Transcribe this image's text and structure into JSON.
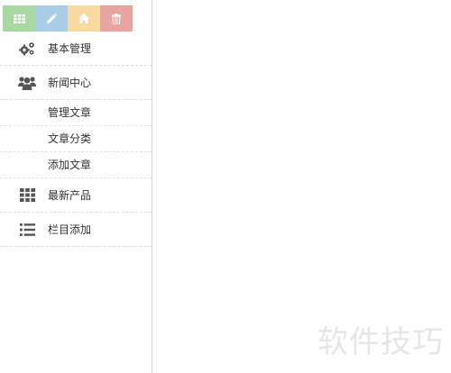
{
  "shortcuts": [
    {
      "icon": "grid-icon",
      "color": "#a8d9a0"
    },
    {
      "icon": "pencil-icon",
      "color": "#a9cde6"
    },
    {
      "icon": "home-icon",
      "color": "#f8d99f"
    },
    {
      "icon": "trash-icon",
      "color": "#e8a4a0"
    }
  ],
  "nav": {
    "basic_management": {
      "label": "基本管理",
      "icon": "gears-icon"
    },
    "news_center": {
      "label": "新闻中心",
      "icon": "users-icon",
      "children": [
        {
          "label": "管理文章"
        },
        {
          "label": "文章分类"
        },
        {
          "label": "添加文章"
        }
      ]
    },
    "latest_products": {
      "label": "最新产品",
      "icon": "grid-icon"
    },
    "column_add": {
      "label": "栏目添加",
      "icon": "list-icon"
    }
  },
  "watermark": "软件技巧",
  "colors": {
    "icon": "#555555",
    "divider": "#dddddd",
    "sidebar_border": "#d5d5d5"
  }
}
